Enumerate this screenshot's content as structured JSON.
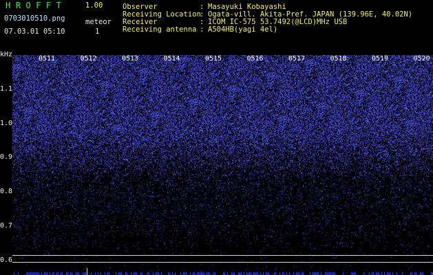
{
  "app": {
    "name": "HROFFT",
    "version": "1.00",
    "file_name": "0703010510.png",
    "timestamp": "07.03.01 05:10",
    "meteor_label": "meteor",
    "meteor_count": "1"
  },
  "header": {
    "rows": [
      {
        "label": "Observer",
        "value": "Masayuki Kobayashi"
      },
      {
        "label": "Receiving Location",
        "value": "Ogata-vill. Akita-Pref. JAPAN (139.96E, 40.02N)"
      },
      {
        "label": "Receiver",
        "value": "ICOM IC-575 53.7492(@LCD)MHz USB"
      },
      {
        "label": "Receiving antenna",
        "value": "A504HB(yagi 4el)"
      }
    ],
    "separator": ":"
  },
  "axis": {
    "y_unit": "kHz",
    "y_ticks": [
      "1.1",
      "1.0",
      "0.9",
      "0.8",
      "0.7",
      "0.6"
    ],
    "time_ticks": [
      "0511",
      "0512",
      "0513",
      "0514",
      "0515",
      "0516",
      "0517",
      "0518",
      "0519",
      "0520"
    ]
  },
  "colors": {
    "background": "#000000",
    "signal": "#3c46ff",
    "label_yellow": "#f4f44a",
    "label_green": "#2bff2b"
  }
}
